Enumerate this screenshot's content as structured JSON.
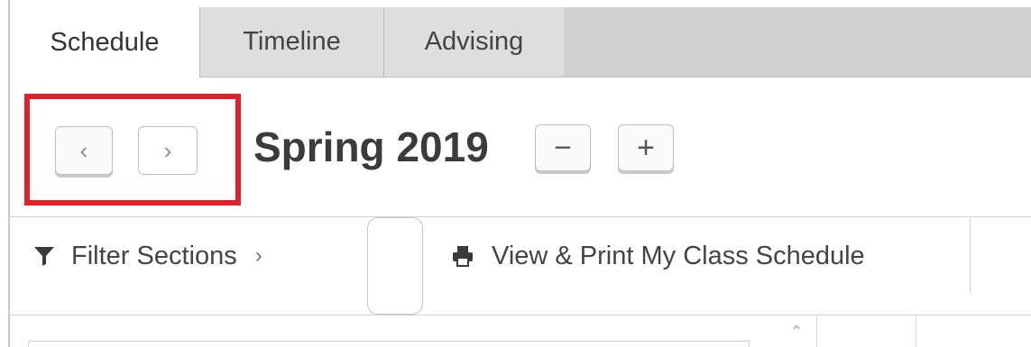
{
  "tabs": [
    {
      "label": "Schedule",
      "active": true
    },
    {
      "label": "Timeline",
      "active": false
    },
    {
      "label": "Advising",
      "active": false
    }
  ],
  "term": {
    "title": "Spring 2019",
    "prev_glyph": "‹",
    "next_glyph": "›",
    "zoom_out_glyph": "−",
    "zoom_in_glyph": "+"
  },
  "toolbar": {
    "filter_label": "Filter Sections",
    "filter_chevron": "›",
    "print_label": "View & Print My Class Schedule"
  },
  "list": {
    "scroll_up_glyph": "⌃"
  },
  "icons": {
    "filter": "funnel-icon",
    "print": "printer-icon"
  },
  "colors": {
    "highlight": "#e0202a",
    "tab_inactive": "#dedede",
    "tab_strip": "#d0d0d0"
  }
}
